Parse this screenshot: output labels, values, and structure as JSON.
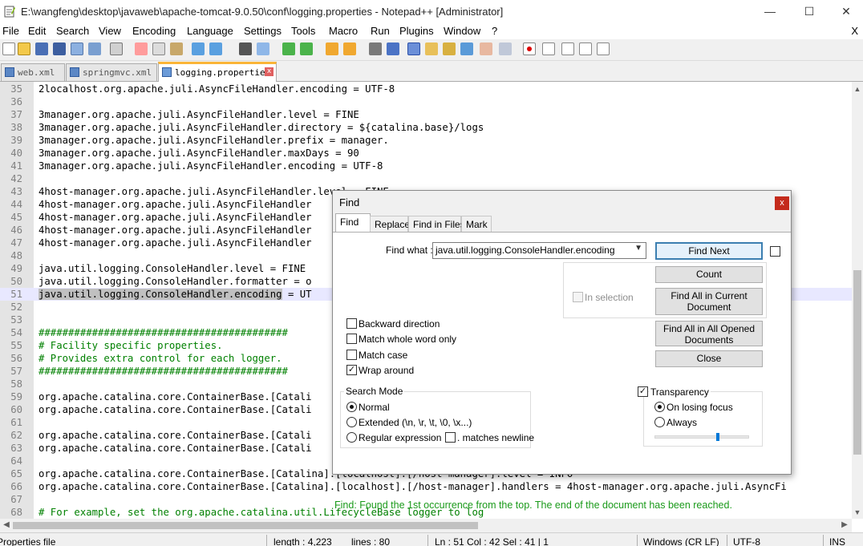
{
  "window": {
    "title": "E:\\wangfeng\\desktop\\javaweb\\apache-tomcat-9.0.50\\conf\\logging.properties - Notepad++ [Administrator]",
    "minimize": "—",
    "maximize": "☐",
    "close": "✕"
  },
  "menu": {
    "items": [
      "File",
      "Edit",
      "Search",
      "View",
      "Encoding",
      "Language",
      "Settings",
      "Tools",
      "Macro",
      "Run",
      "Plugins",
      "Window",
      "?"
    ],
    "close_doc": "X"
  },
  "tabs": [
    {
      "label": "web.xml",
      "active": false
    },
    {
      "label": "springmvc.xml",
      "active": false
    },
    {
      "label": "logging.properties",
      "active": true
    }
  ],
  "editor": {
    "lines": [
      {
        "n": "35",
        "text": "2localhost.org.apache.juli.AsyncFileHandler.encoding = UTF-8"
      },
      {
        "n": "36",
        "text": ""
      },
      {
        "n": "37",
        "text": "3manager.org.apache.juli.AsyncFileHandler.level = FINE"
      },
      {
        "n": "38",
        "text": "3manager.org.apache.juli.AsyncFileHandler.directory = ${catalina.base}/logs"
      },
      {
        "n": "39",
        "text": "3manager.org.apache.juli.AsyncFileHandler.prefix = manager."
      },
      {
        "n": "40",
        "text": "3manager.org.apache.juli.AsyncFileHandler.maxDays = 90"
      },
      {
        "n": "41",
        "text": "3manager.org.apache.juli.AsyncFileHandler.encoding = UTF-8"
      },
      {
        "n": "42",
        "text": ""
      },
      {
        "n": "43",
        "text": "4host-manager.org.apache.juli.AsyncFileHandler.level = FINE"
      },
      {
        "n": "44",
        "text": "4host-manager.org.apache.juli.AsyncFileHandler"
      },
      {
        "n": "45",
        "text": "4host-manager.org.apache.juli.AsyncFileHandler"
      },
      {
        "n": "46",
        "text": "4host-manager.org.apache.juli.AsyncFileHandler"
      },
      {
        "n": "47",
        "text": "4host-manager.org.apache.juli.AsyncFileHandler"
      },
      {
        "n": "48",
        "text": ""
      },
      {
        "n": "49",
        "text": "java.util.logging.ConsoleHandler.level = FINE"
      },
      {
        "n": "50",
        "text": "java.util.logging.ConsoleHandler.formatter = o"
      },
      {
        "n": "51",
        "text": " = UT",
        "selected": "java.util.logging.ConsoleHandler.encoding"
      },
      {
        "n": "52",
        "text": ""
      },
      {
        "n": "53",
        "text": ""
      },
      {
        "n": "54",
        "text": "##########################################",
        "comment": true
      },
      {
        "n": "55",
        "text": "# Facility specific properties.",
        "comment": true
      },
      {
        "n": "56",
        "text": "# Provides extra control for each logger.",
        "comment": true
      },
      {
        "n": "57",
        "text": "##########################################",
        "comment": true
      },
      {
        "n": "58",
        "text": ""
      },
      {
        "n": "59",
        "text": "org.apache.catalina.core.ContainerBase.[Catali"
      },
      {
        "n": "60",
        "text": "org.apache.catalina.core.ContainerBase.[Catali"
      },
      {
        "n": "61",
        "text": ""
      },
      {
        "n": "62",
        "text": "org.apache.catalina.core.ContainerBase.[Catali"
      },
      {
        "n": "63",
        "text": "org.apache.catalina.core.ContainerBase.[Catali                                                                   eHandler"
      },
      {
        "n": "64",
        "text": ""
      },
      {
        "n": "65",
        "text": "org.apache.catalina.core.ContainerBase.[Catalina].[localhost].[/host-manager].level = INFO"
      },
      {
        "n": "66",
        "text": "org.apache.catalina.core.ContainerBase.[Catalina].[localhost].[/host-manager].handlers = 4host-manager.org.apache.juli.AsyncFi"
      },
      {
        "n": "67",
        "text": ""
      },
      {
        "n": "68",
        "text": "# For example, set the org.apache.catalina.util.LifecycleBase logger to log",
        "comment": true
      }
    ]
  },
  "statusbar": {
    "file_type": "Properties file",
    "length": "length : 4,223",
    "lines": "lines : 80",
    "pos": "Ln : 51    Col : 42    Sel : 41 | 1",
    "eol": "Windows (CR LF)",
    "encoding": "UTF-8",
    "mode": "INS"
  },
  "find": {
    "title": "Find",
    "close": "x",
    "tabs": [
      "Find",
      "Replace",
      "Find in Files",
      "Mark"
    ],
    "find_what_label": "Find what :",
    "find_what_value": "java.util.logging.ConsoleHandler.encoding",
    "buttons": {
      "find_next": "Find Next",
      "count": "Count",
      "find_all_current_1": "Find All in Current",
      "find_all_current_2": "Document",
      "find_all_opened_1": "Find All in All Opened",
      "find_all_opened_2": "Documents",
      "close": "Close"
    },
    "in_selection": "In selection",
    "options": [
      {
        "label": "Backward direction",
        "checked": false
      },
      {
        "label": "Match whole word only",
        "checked": false
      },
      {
        "label": "Match case",
        "checked": false
      },
      {
        "label": "Wrap around",
        "checked": true
      }
    ],
    "search_mode": {
      "title": "Search Mode",
      "normal": "Normal",
      "extended": "Extended (\\n, \\r, \\t, \\0, \\x...)",
      "regex": "Regular expression",
      "matches_newline": ". matches newline",
      "selected": "normal"
    },
    "transparency": {
      "title": "Transparency",
      "checked": true,
      "on_losing_focus": "On losing focus",
      "always": "Always",
      "selected": "on_losing_focus",
      "level": 0.65
    },
    "status": "Find: Found the 1st occurrence from the top. The end of the document has been reached."
  },
  "colors": {
    "comment": "#008000",
    "find_status": "#1a9a1a",
    "active_tab_accent": "#fab437"
  }
}
